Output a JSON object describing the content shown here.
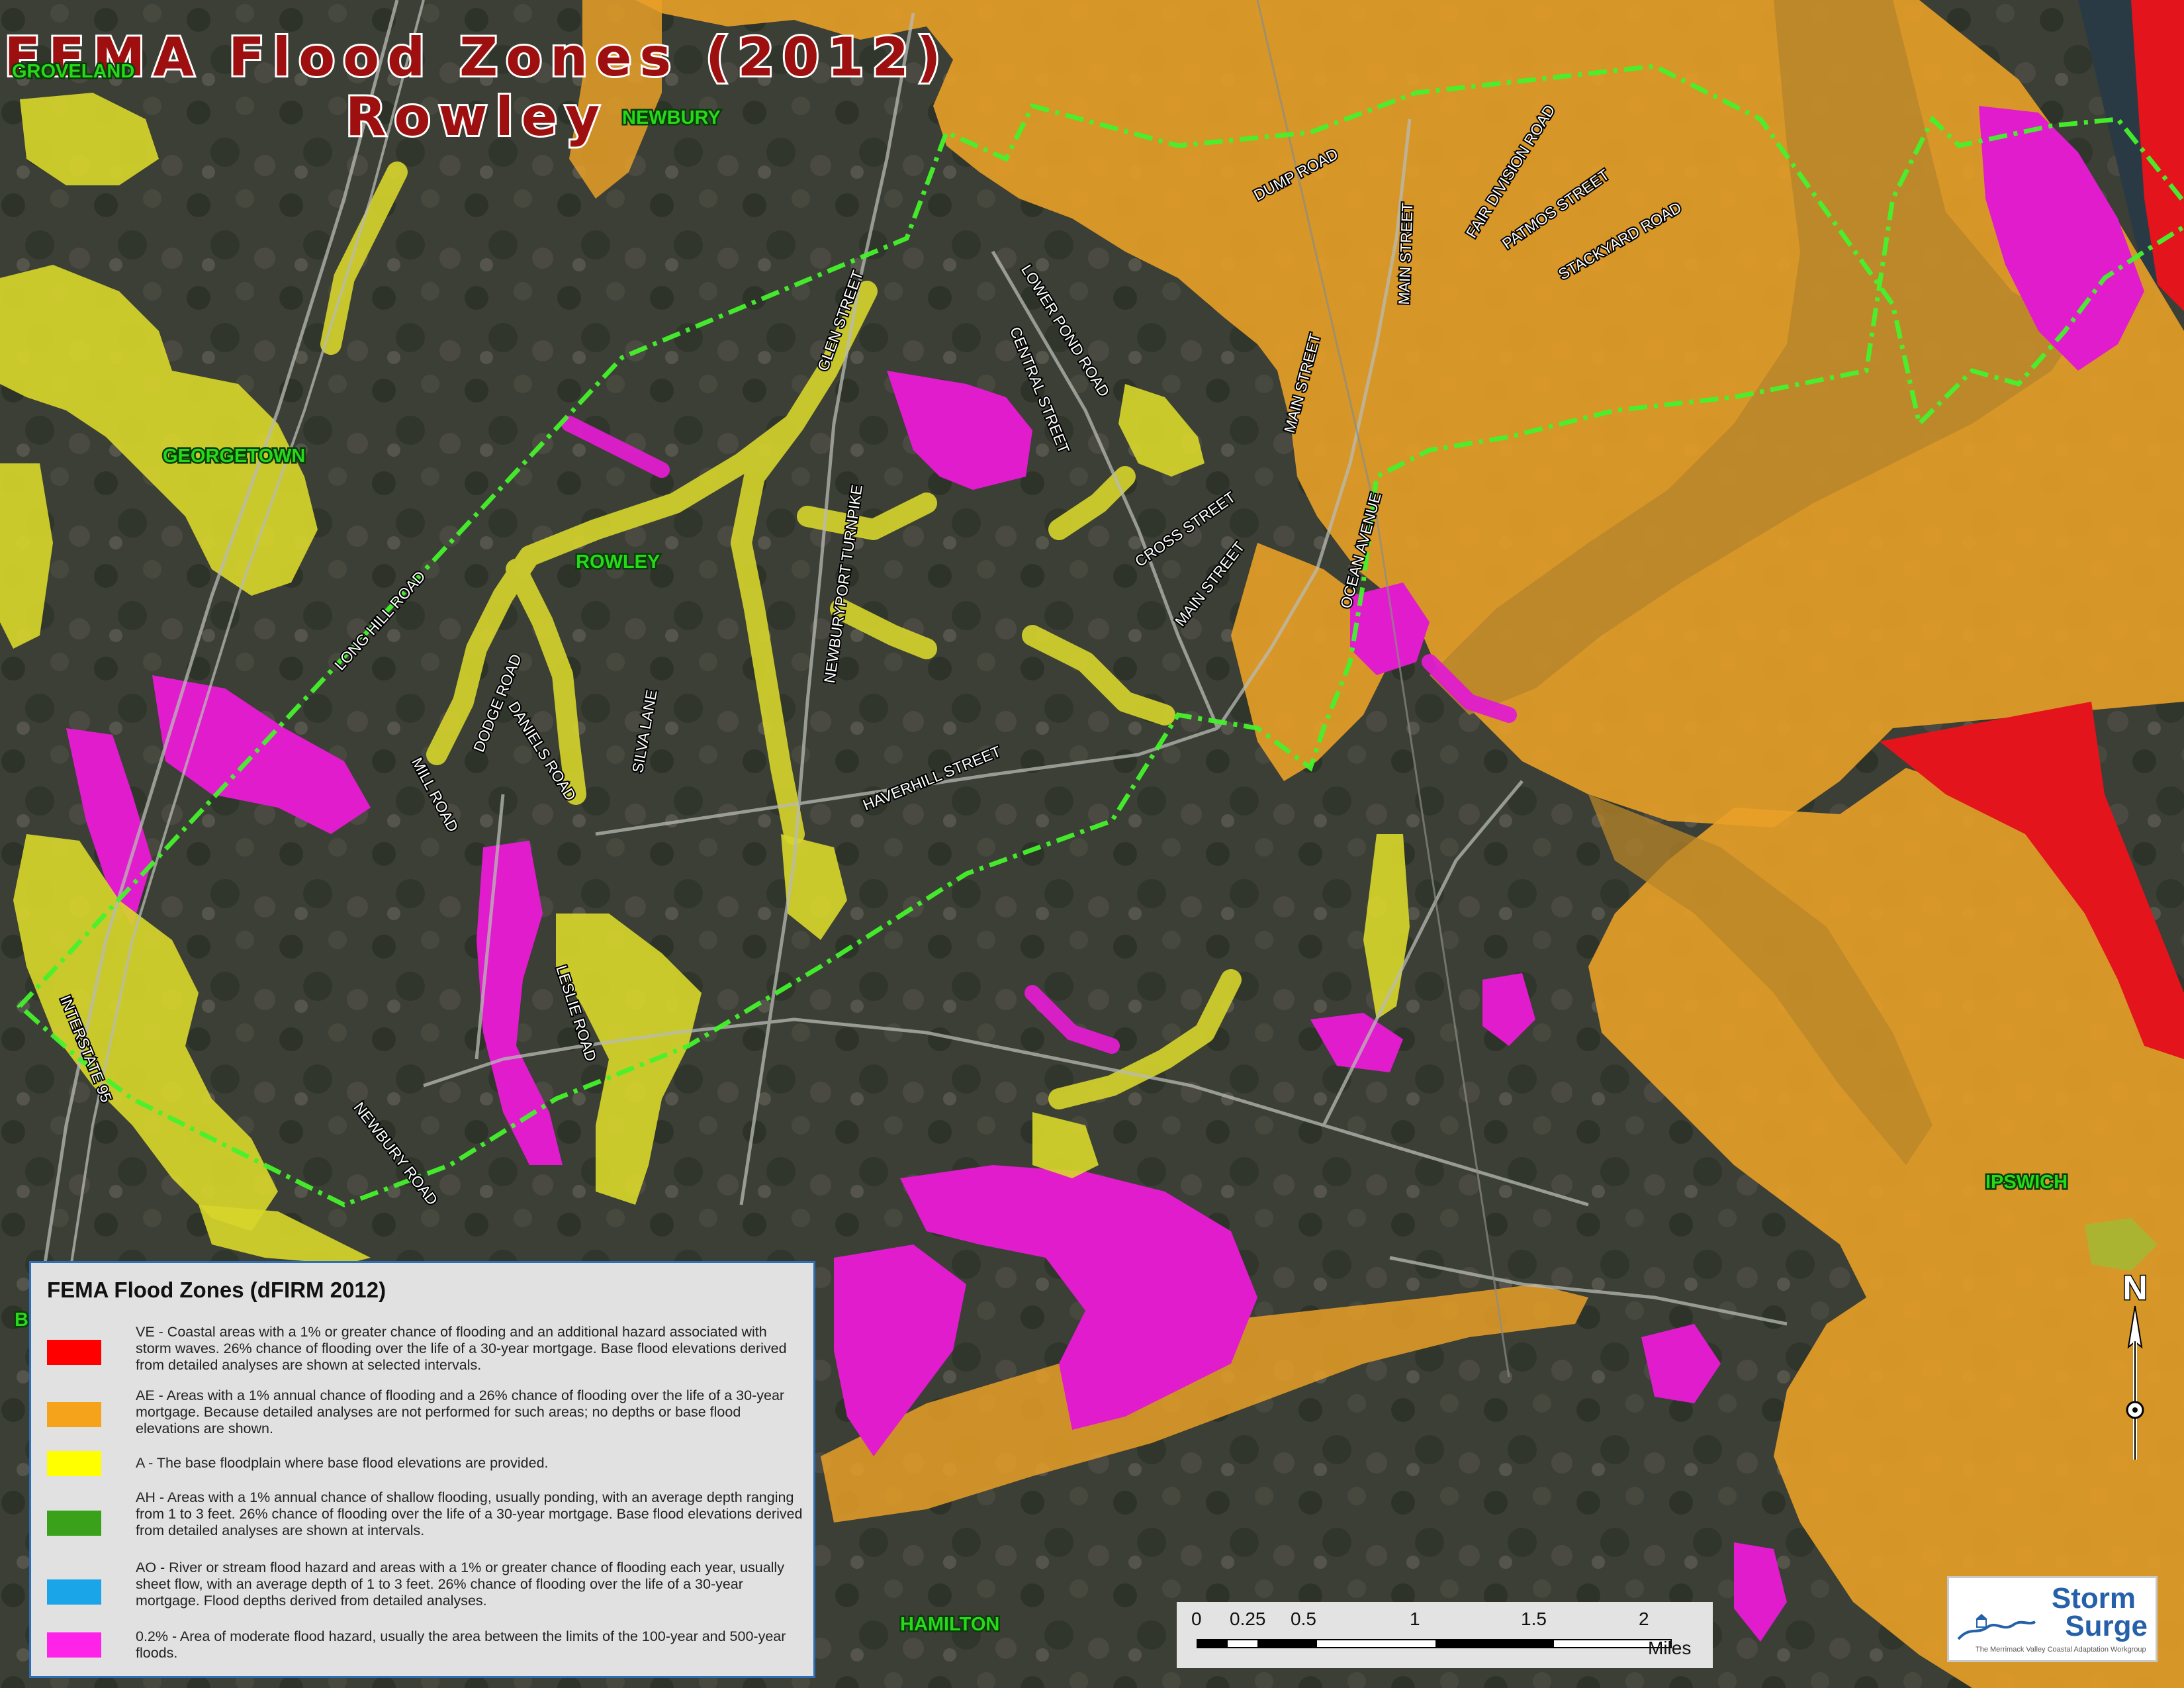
{
  "title": {
    "line1": "FEMA Flood Zones (2012)",
    "line2": "Rowley"
  },
  "towns": {
    "groveland": "GROVELAND",
    "newbury": "NEWBURY",
    "georgetown": "GEORGETOWN",
    "rowley": "ROWLEY",
    "ipswich": "IPSWICH",
    "hamilton": "HAMILTON",
    "boxford": "B"
  },
  "roads": {
    "dump_road": "DUMP ROAD",
    "main_street_n": "MAIN STREET",
    "fair_division_road": "FAIR DIVISION ROAD",
    "patmos_street": "PATMOS STREET",
    "stackyard_road": "STACKYARD ROAD",
    "glen_street": "GLEN STREET",
    "lower_pond_road": "LOWER POND ROAD",
    "central_street": "CENTRAL STREET",
    "main_street_mid": "MAIN STREET",
    "cross_street": "CROSS STREET",
    "main_street_s": "MAIN STREET",
    "ocean_avenue": "OCEAN AVENUE",
    "newburyport_turnpike": "NEWBURYPORT TURNPIKE",
    "long_hill_road": "LONG HILL ROAD",
    "dodge_road": "DODGE ROAD",
    "daniels_road": "DANIELS ROAD",
    "silva_lane": "SILVA LANE",
    "mill_road": "MILL ROAD",
    "haverhill_street": "HAVERHILL STREET",
    "leslie_road": "LESLIE ROAD",
    "interstate_95": "INTERSTATE 95",
    "newbury_road": "NEWBURY ROAD"
  },
  "legend": {
    "title": "FEMA Flood Zones (dFIRM 2012)",
    "items": [
      {
        "color": "#ff0000",
        "text": "VE - Coastal areas with a 1% or greater chance of flooding and an additional hazard associated with storm waves. 26% chance of flooding over the life of a 30-year mortgage. Base flood elevations derived from detailed analyses are shown at selected intervals."
      },
      {
        "color": "#f5a31a",
        "text": "AE - Areas with a 1% annual chance of flooding and a 26% chance of flooding over the life of a 30-year mortgage. Because detailed analyses are not performed for such areas; no depths or base flood elevations are shown."
      },
      {
        "color": "#ffff00",
        "text": "A - The base floodplain where base flood elevations are provided."
      },
      {
        "color": "#3aa21a",
        "text": "AH - Areas with a 1% annual chance of shallow flooding, usually ponding, with an average depth ranging from 1 to 3 feet. 26% chance of flooding over the life of a 30-year mortgage. Base flood elevations derived from detailed analyses are shown at intervals."
      },
      {
        "color": "#1aa5e8",
        "text": "AO - River or stream flood hazard and areas with a 1% or greater chance of flooding each year, usually sheet flow, with an average depth of 1 to 3 feet. 26% chance of flooding over the life of a 30-year mortgage. Flood depths derived from detailed analyses."
      },
      {
        "color": "#ff22e8",
        "text": "0.2% - Area of moderate flood hazard, usually the area between the limits of the 100-year and 500-year floods."
      }
    ]
  },
  "scale_bar": {
    "labels": [
      "0",
      "0.25",
      "0.5",
      "1",
      "1.5",
      "2"
    ],
    "unit": "Miles"
  },
  "north_arrow": {
    "label": "N",
    "icon": "north-arrow-icon"
  },
  "logo": {
    "line1": "Storm",
    "line2": "Surge",
    "tagline": "The Merrimack Valley Coastal Adaptation Workgroup"
  },
  "colors": {
    "ve": "#e3141c",
    "ae": "#e9a027",
    "a": "#d7d52b",
    "x500": "#e01ccd",
    "boundary": "#45f22c",
    "estuary": "#b8862a"
  }
}
